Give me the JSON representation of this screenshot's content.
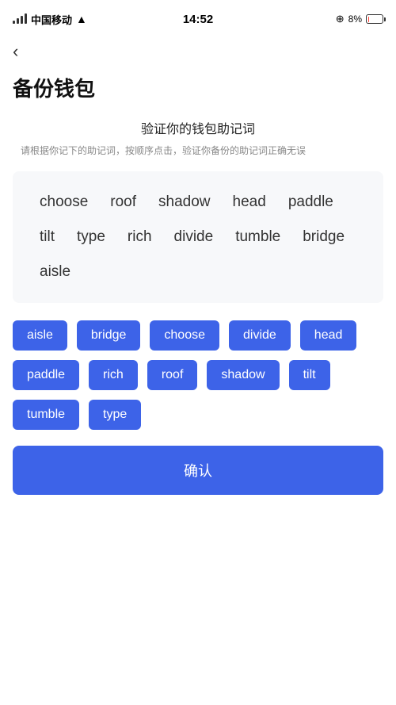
{
  "statusBar": {
    "carrier": "中国移动",
    "time": "14:52",
    "batteryPercent": "8%"
  },
  "header": {
    "backIcon": "‹",
    "pageTitle": "备份钱包"
  },
  "instruction": {
    "title": "验证你的钱包助记词",
    "description": "请根据你记下的助记词，按顺序点击，验证你备份的助记词正确无误"
  },
  "displayWords": [
    "choose",
    "roof",
    "shadow",
    "head",
    "paddle",
    "tilt",
    "type",
    "rich",
    "divide",
    "tumble",
    "bridge",
    "aisle"
  ],
  "selectableWords": [
    "aisle",
    "bridge",
    "choose",
    "divide",
    "head",
    "paddle",
    "rich",
    "roof",
    "shadow",
    "tilt",
    "tumble",
    "type"
  ],
  "confirmButton": {
    "label": "确认"
  }
}
